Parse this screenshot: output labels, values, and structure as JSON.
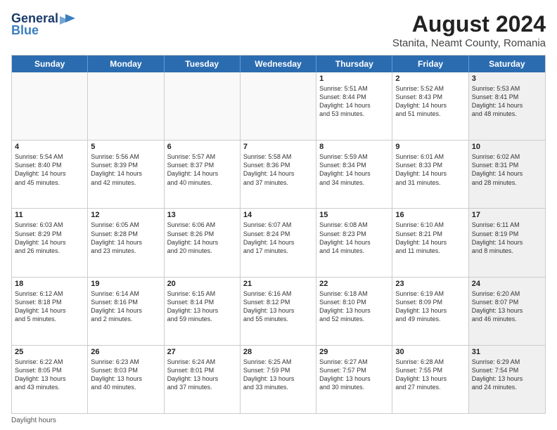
{
  "header": {
    "logo_line1": "General",
    "logo_line2": "Blue",
    "main_title": "August 2024",
    "subtitle": "Stanita, Neamt County, Romania"
  },
  "calendar": {
    "days": [
      "Sunday",
      "Monday",
      "Tuesday",
      "Wednesday",
      "Thursday",
      "Friday",
      "Saturday"
    ],
    "rows": [
      [
        {
          "day": "",
          "text": "",
          "empty": true
        },
        {
          "day": "",
          "text": "",
          "empty": true
        },
        {
          "day": "",
          "text": "",
          "empty": true
        },
        {
          "day": "",
          "text": "",
          "empty": true
        },
        {
          "day": "1",
          "text": "Sunrise: 5:51 AM\nSunset: 8:44 PM\nDaylight: 14 hours\nand 53 minutes.",
          "empty": false
        },
        {
          "day": "2",
          "text": "Sunrise: 5:52 AM\nSunset: 8:43 PM\nDaylight: 14 hours\nand 51 minutes.",
          "empty": false
        },
        {
          "day": "3",
          "text": "Sunrise: 5:53 AM\nSunset: 8:41 PM\nDaylight: 14 hours\nand 48 minutes.",
          "empty": false,
          "shaded": true
        }
      ],
      [
        {
          "day": "4",
          "text": "Sunrise: 5:54 AM\nSunset: 8:40 PM\nDaylight: 14 hours\nand 45 minutes.",
          "empty": false
        },
        {
          "day": "5",
          "text": "Sunrise: 5:56 AM\nSunset: 8:39 PM\nDaylight: 14 hours\nand 42 minutes.",
          "empty": false
        },
        {
          "day": "6",
          "text": "Sunrise: 5:57 AM\nSunset: 8:37 PM\nDaylight: 14 hours\nand 40 minutes.",
          "empty": false
        },
        {
          "day": "7",
          "text": "Sunrise: 5:58 AM\nSunset: 8:36 PM\nDaylight: 14 hours\nand 37 minutes.",
          "empty": false
        },
        {
          "day": "8",
          "text": "Sunrise: 5:59 AM\nSunset: 8:34 PM\nDaylight: 14 hours\nand 34 minutes.",
          "empty": false
        },
        {
          "day": "9",
          "text": "Sunrise: 6:01 AM\nSunset: 8:33 PM\nDaylight: 14 hours\nand 31 minutes.",
          "empty": false
        },
        {
          "day": "10",
          "text": "Sunrise: 6:02 AM\nSunset: 8:31 PM\nDaylight: 14 hours\nand 28 minutes.",
          "empty": false,
          "shaded": true
        }
      ],
      [
        {
          "day": "11",
          "text": "Sunrise: 6:03 AM\nSunset: 8:29 PM\nDaylight: 14 hours\nand 26 minutes.",
          "empty": false
        },
        {
          "day": "12",
          "text": "Sunrise: 6:05 AM\nSunset: 8:28 PM\nDaylight: 14 hours\nand 23 minutes.",
          "empty": false
        },
        {
          "day": "13",
          "text": "Sunrise: 6:06 AM\nSunset: 8:26 PM\nDaylight: 14 hours\nand 20 minutes.",
          "empty": false
        },
        {
          "day": "14",
          "text": "Sunrise: 6:07 AM\nSunset: 8:24 PM\nDaylight: 14 hours\nand 17 minutes.",
          "empty": false
        },
        {
          "day": "15",
          "text": "Sunrise: 6:08 AM\nSunset: 8:23 PM\nDaylight: 14 hours\nand 14 minutes.",
          "empty": false
        },
        {
          "day": "16",
          "text": "Sunrise: 6:10 AM\nSunset: 8:21 PM\nDaylight: 14 hours\nand 11 minutes.",
          "empty": false
        },
        {
          "day": "17",
          "text": "Sunrise: 6:11 AM\nSunset: 8:19 PM\nDaylight: 14 hours\nand 8 minutes.",
          "empty": false,
          "shaded": true
        }
      ],
      [
        {
          "day": "18",
          "text": "Sunrise: 6:12 AM\nSunset: 8:18 PM\nDaylight: 14 hours\nand 5 minutes.",
          "empty": false
        },
        {
          "day": "19",
          "text": "Sunrise: 6:14 AM\nSunset: 8:16 PM\nDaylight: 14 hours\nand 2 minutes.",
          "empty": false
        },
        {
          "day": "20",
          "text": "Sunrise: 6:15 AM\nSunset: 8:14 PM\nDaylight: 13 hours\nand 59 minutes.",
          "empty": false
        },
        {
          "day": "21",
          "text": "Sunrise: 6:16 AM\nSunset: 8:12 PM\nDaylight: 13 hours\nand 55 minutes.",
          "empty": false
        },
        {
          "day": "22",
          "text": "Sunrise: 6:18 AM\nSunset: 8:10 PM\nDaylight: 13 hours\nand 52 minutes.",
          "empty": false
        },
        {
          "day": "23",
          "text": "Sunrise: 6:19 AM\nSunset: 8:09 PM\nDaylight: 13 hours\nand 49 minutes.",
          "empty": false
        },
        {
          "day": "24",
          "text": "Sunrise: 6:20 AM\nSunset: 8:07 PM\nDaylight: 13 hours\nand 46 minutes.",
          "empty": false,
          "shaded": true
        }
      ],
      [
        {
          "day": "25",
          "text": "Sunrise: 6:22 AM\nSunset: 8:05 PM\nDaylight: 13 hours\nand 43 minutes.",
          "empty": false
        },
        {
          "day": "26",
          "text": "Sunrise: 6:23 AM\nSunset: 8:03 PM\nDaylight: 13 hours\nand 40 minutes.",
          "empty": false
        },
        {
          "day": "27",
          "text": "Sunrise: 6:24 AM\nSunset: 8:01 PM\nDaylight: 13 hours\nand 37 minutes.",
          "empty": false
        },
        {
          "day": "28",
          "text": "Sunrise: 6:25 AM\nSunset: 7:59 PM\nDaylight: 13 hours\nand 33 minutes.",
          "empty": false
        },
        {
          "day": "29",
          "text": "Sunrise: 6:27 AM\nSunset: 7:57 PM\nDaylight: 13 hours\nand 30 minutes.",
          "empty": false
        },
        {
          "day": "30",
          "text": "Sunrise: 6:28 AM\nSunset: 7:55 PM\nDaylight: 13 hours\nand 27 minutes.",
          "empty": false
        },
        {
          "day": "31",
          "text": "Sunrise: 6:29 AM\nSunset: 7:54 PM\nDaylight: 13 hours\nand 24 minutes.",
          "empty": false,
          "shaded": true
        }
      ]
    ]
  },
  "footer": {
    "note": "Daylight hours"
  }
}
